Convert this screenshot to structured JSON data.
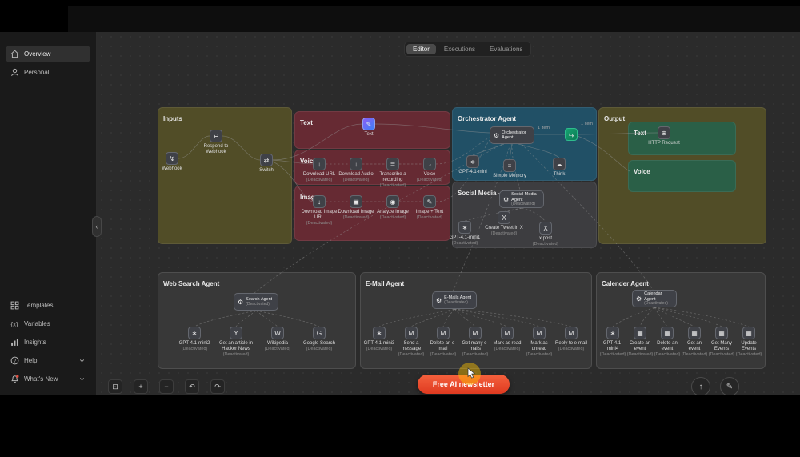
{
  "window": {
    "tabs": [
      {
        "label": "Editor"
      },
      {
        "label": "Executions"
      },
      {
        "label": "Evaluations"
      }
    ]
  },
  "sidebar": {
    "overview": "Overview",
    "personal": "Personal",
    "templates": "Templates",
    "variables": "Variables",
    "insights": "Insights",
    "help": "Help",
    "whats_new": "What's New"
  },
  "canvas": {
    "groups": {
      "inputs": {
        "title": "Inputs"
      },
      "text_in": {
        "title": "Text"
      },
      "voice_in": {
        "title": "Voice"
      },
      "image_in": {
        "title": "Image"
      },
      "orchestrator": {
        "title": "Orchestrator Agent"
      },
      "social": {
        "title": "Social Media - Twitter"
      },
      "output": {
        "title": "Output"
      },
      "output_text": {
        "title": "Text"
      },
      "output_voice": {
        "title": "Voice"
      },
      "web_search": {
        "title": "Web Search Agent"
      },
      "email": {
        "title": "E-Mail Agent"
      },
      "calendar": {
        "title": "Calender Agent"
      }
    },
    "nodes": {
      "webhook": {
        "glyph": "↯",
        "label": "Webhook"
      },
      "respond": {
        "glyph": "↩",
        "label": "Respond to Webhook"
      },
      "switch": {
        "glyph": "⇄",
        "label": "Switch"
      },
      "text": {
        "glyph": "✎",
        "label": "Text"
      },
      "filter": {
        "glyph": "⇆"
      },
      "http": {
        "glyph": "⊕",
        "label": "HTTP Request"
      },
      "orch_agent": {
        "glyph": "⚙",
        "label": "Orchestrator Agent",
        "sub": ""
      },
      "orch_gpt": {
        "glyph": "∗",
        "label": "GPT-4.1-mini"
      },
      "orch_memory": {
        "glyph": "≡",
        "label": "Simple Memory"
      },
      "orch_think": {
        "glyph": "☁",
        "label": "Think"
      },
      "social_agent": {
        "glyph": "⚙",
        "label": "Social Media Agent",
        "sub": "(Deactivated)"
      },
      "search_agent": {
        "glyph": "⚙",
        "label": "Search Agent",
        "sub": "(Deactivated)"
      },
      "email_agent": {
        "glyph": "⚙",
        "label": "E-Mails Agent",
        "sub": "(Deactivated)"
      },
      "calendar_agent": {
        "glyph": "⚙",
        "label": "Calendar Agent",
        "sub": "(Deactivated)"
      }
    },
    "rows": {
      "voice": [
        {
          "glyph": "↓",
          "label": "Download URL",
          "sub": "(Deactivated)"
        },
        {
          "glyph": "↓",
          "label": "Download Audio",
          "sub": "(Deactivated)"
        },
        {
          "glyph": "≣",
          "label": "Transcribe a recording",
          "sub": "(Deactivated)"
        },
        {
          "glyph": "♪",
          "label": "Voice",
          "sub": "(Deactivated)"
        }
      ],
      "image": [
        {
          "glyph": "↓",
          "label": "Download Image URL",
          "sub": "(Deactivated)"
        },
        {
          "glyph": "▣",
          "label": "Download Image",
          "sub": "(Deactivated)"
        },
        {
          "glyph": "◉",
          "label": "Analyze Image",
          "sub": "(Deactivated)"
        },
        {
          "glyph": "✎",
          "label": "Image + Text",
          "sub": "(Deactivated)"
        }
      ],
      "social_tools": [
        {
          "glyph": "∗",
          "label": "GPT-4.1-mini1",
          "sub": "(Deactivated)"
        },
        {
          "glyph": "X",
          "label": "Create Tweet in X",
          "sub": "(Deactivated)"
        },
        {
          "glyph": "X",
          "label": "x post",
          "sub": "(Deactivated)"
        }
      ],
      "web_tools": [
        {
          "glyph": "∗",
          "label": "GPT-4.1-mini2",
          "sub": "(Deactivated)"
        },
        {
          "glyph": "Y",
          "label": "Get an article in Hacker News",
          "sub": "(Deactivated)"
        },
        {
          "glyph": "W",
          "label": "Wikipedia",
          "sub": "(Deactivated)"
        },
        {
          "glyph": "G",
          "label": "Google Search",
          "sub": "(Deactivated)"
        }
      ],
      "email_tools": [
        {
          "glyph": "∗",
          "label": "GPT-4.1-mini3",
          "sub": "(Deactivated)"
        },
        {
          "glyph": "M",
          "label": "Send a message",
          "sub": "(Deactivated)"
        },
        {
          "glyph": "M",
          "label": "Delete an e-mail",
          "sub": "(Deactivated)"
        },
        {
          "glyph": "M",
          "label": "Get many e-mails",
          "sub": "(Deactivated)"
        },
        {
          "glyph": "M",
          "label": "Mark as read",
          "sub": "(Deactivated)"
        },
        {
          "glyph": "M",
          "label": "Mark as unread",
          "sub": "(Deactivated)"
        },
        {
          "glyph": "M",
          "label": "Reply to e-mail",
          "sub": "(Deactivated)"
        }
      ],
      "calendar_tools": [
        {
          "glyph": "∗",
          "label": "GPT-4.1-mini4",
          "sub": "(Deactivated)"
        },
        {
          "glyph": "▦",
          "label": "Create an event",
          "sub": "(Deactivated)"
        },
        {
          "glyph": "▦",
          "label": "Delete an event",
          "sub": "(Deactivated)"
        },
        {
          "glyph": "▦",
          "label": "Get an event",
          "sub": "(Deactivated)"
        },
        {
          "glyph": "▦",
          "label": "Get Many Events",
          "sub": "(Deactivated)"
        },
        {
          "glyph": "▦",
          "label": "Update Events",
          "sub": "(Deactivated)"
        }
      ]
    },
    "connection_labels": {
      "a": "1 item",
      "b": "1 item"
    },
    "toolbar": [
      {
        "glyph": "⊡"
      },
      {
        "glyph": "+"
      },
      {
        "glyph": "−"
      },
      {
        "glyph": "↶"
      },
      {
        "glyph": "↷"
      }
    ],
    "cta": {
      "label": "Free AI newsletter"
    },
    "collapse_glyph": "‹",
    "fab1_glyph": "↑",
    "fab2_glyph": "✎"
  }
}
